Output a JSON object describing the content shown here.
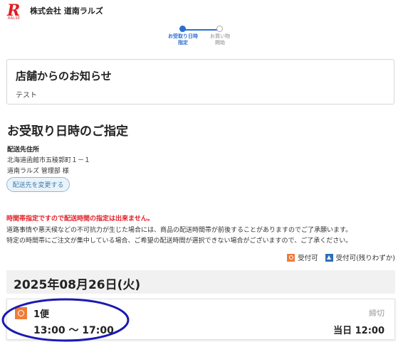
{
  "header": {
    "logo_letter": "R",
    "logo_sub": "RALSE",
    "company_name": "株式会社 道南ラルズ"
  },
  "stepper": {
    "steps": [
      {
        "label_line1": "お受取り日時",
        "label_line2": "指定",
        "state": "active"
      },
      {
        "label_line1": "お買い物",
        "label_line2": "開始",
        "state": "inactive"
      }
    ]
  },
  "notice": {
    "title": "店舗からのお知らせ",
    "body": "テスト"
  },
  "delivery": {
    "section_title": "お受取り日時のご指定",
    "address_label": "配送先住所",
    "address_line1": "北海道函館市五稜郭町１－１",
    "address_line2": "道南ラルズ 管理部 様",
    "change_button": "配送先を変更する"
  },
  "warnings": {
    "red": "時間帯指定ですので配送時間の指定は出来ません。",
    "line1": "道路事情や悪天候などの不可抗力が生じた場合には、商品の配送時間帯が前後することがありますのでご了承願います。",
    "line2": "特定の時間帯にご注文が集中している場合、ご希望の配送時間が選択できない場合がございますので、ご了承ください。"
  },
  "legend": {
    "available": "受付可",
    "few_left": "受付可(残りわずか)"
  },
  "date_header": "2025年08月26日(火)",
  "slot": {
    "name": "1便",
    "time": "13:00 ～ 17:00",
    "cutoff_label": "締切",
    "cutoff_time": "当日 12:00",
    "status": "available"
  },
  "colors": {
    "brand_red": "#e01e25",
    "accent_blue": "#2c6fd1",
    "available_orange": "#ee7d3b",
    "few_left_blue": "#2f6fb7",
    "annotation_ellipse": "#1a1ab3"
  },
  "icons": {
    "logo": "raise-logo-icon",
    "available": "circle-in-square-icon",
    "few_left": "triangle-in-square-icon"
  }
}
